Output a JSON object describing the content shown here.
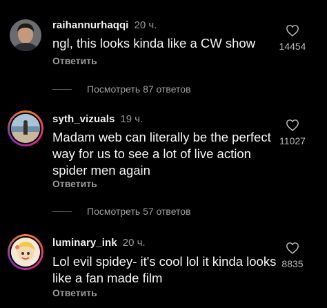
{
  "comments": [
    {
      "username": "raihannurhaqqi",
      "time": "20 ч.",
      "text": "ngl, this looks kinda like a CW show",
      "reply": "Ответить",
      "likes": "14454",
      "view_replies": "Посмотреть 87 ответов"
    },
    {
      "username": "syth_vizuals",
      "time": "19 ч.",
      "text": "Madam web can literally be the perfect way for us to see a lot of live action spider men again",
      "reply": "Ответить",
      "likes": "11027",
      "view_replies": "Посмотреть 57 ответов"
    },
    {
      "username": "luminary_ink",
      "time": "20 ч.",
      "text": "Lol evil spidey- it's cool lol it kinda looks like a fan made film",
      "reply": "Ответить",
      "likes": "8835"
    }
  ],
  "icons": {
    "like": "heart-outline-icon"
  },
  "colors": {
    "background": "#000000",
    "secondary_text": "#9a9a9a"
  }
}
